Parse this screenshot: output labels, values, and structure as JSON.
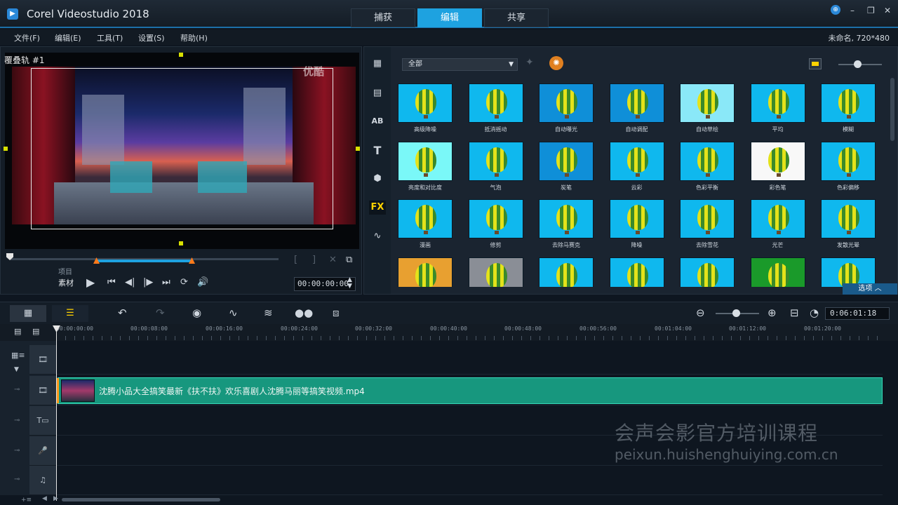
{
  "app": {
    "title": "Corel Videostudio 2018"
  },
  "mode_tabs": [
    {
      "label": "捕获"
    },
    {
      "label": "编辑"
    },
    {
      "label": "共享"
    }
  ],
  "menu": [
    {
      "label": "文件(F)"
    },
    {
      "label": "编辑(E)"
    },
    {
      "label": "工具(T)"
    },
    {
      "label": "设置(S)"
    },
    {
      "label": "帮助(H)"
    }
  ],
  "project_info": "未命名, 720*480",
  "preview": {
    "overlay_label": "覆叠轨 #1",
    "watermark": "优酷",
    "source_project": "项目",
    "source_clip": "素材",
    "timecode": "00:00:00:00"
  },
  "library": {
    "category": "全部",
    "options_label": "选项",
    "active_tab": "FX",
    "effects": [
      [
        "高级降噪",
        "抵消摇动",
        "自动曝光",
        "自动调配",
        "自动草绘",
        "平均",
        "模糊"
      ],
      [
        "亮度和对比度",
        "气泡",
        "炭笔",
        "云彩",
        "色彩平衡",
        "彩色笔",
        "色彩偏移"
      ],
      [
        "漫画",
        "修剪",
        "去除马赛克",
        "降噪",
        "去除雪花",
        "光芒",
        "发散光晕"
      ],
      [
        "",
        "",
        "",
        "",
        "",
        "",
        ""
      ]
    ]
  },
  "timeline": {
    "timecode": "0:06:01:18",
    "ruler": [
      "00:00:00:00",
      "00:00:08:00",
      "00:00:16:00",
      "00:00:24:00",
      "00:00:32:00",
      "00:00:40:00",
      "00:00:48:00",
      "00:00:56:00",
      "00:01:04:00",
      "00:01:12:00",
      "00:01:20:00"
    ],
    "clip_name": "沈腾小品大全搞笑最新《扶不扶》欢乐喜剧人沈腾马丽等搞笑视频.mp4"
  },
  "watermark": {
    "line1": "会声会影官方培训课程",
    "line2": "peixun.huishenghuiying.com.cn"
  }
}
